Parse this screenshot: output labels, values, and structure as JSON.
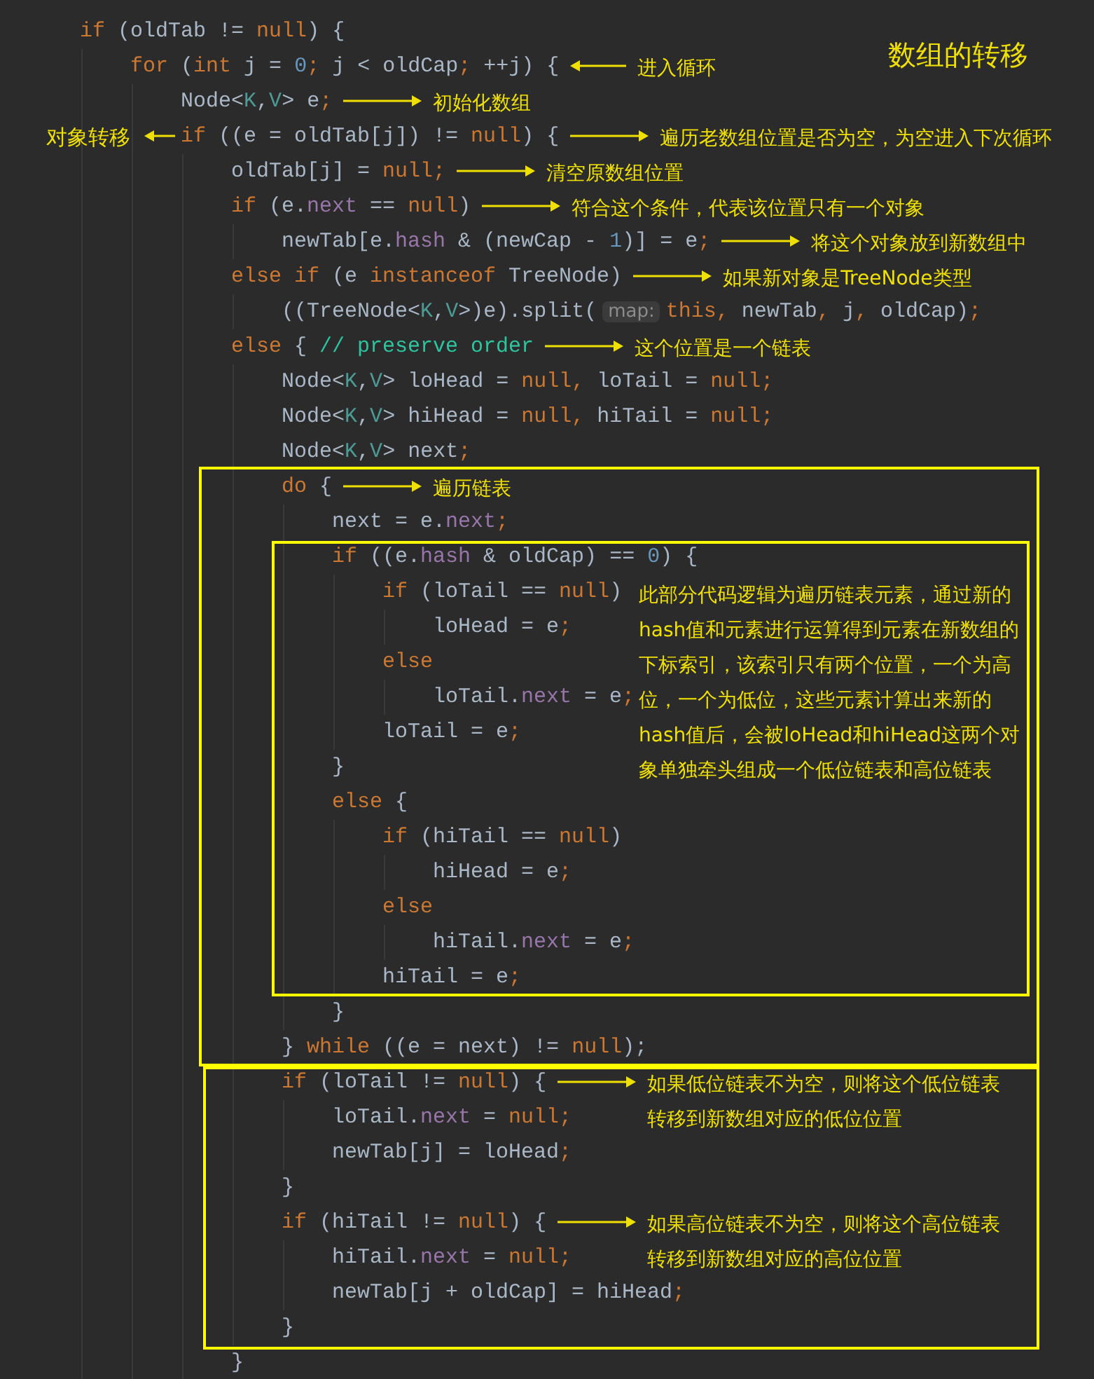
{
  "title": "数组的转移",
  "summary_note": "此部分代码逻辑为遍历链表元素，通过新的hash值和元素进行运算得到元素在新数组的下标索引，该索引只有两个位置，一个为高位，一个为低位，这些元素计算出来新的hash值后，会被loHead和hiHead这两个对象单独牵头组成一个低位链表和高位链表",
  "code": [
    {
      "tokens": [
        {
          "text": "if",
          "kind": "keyword"
        },
        {
          "text": " (oldTab != ",
          "kind": "plain"
        },
        {
          "text": "null",
          "kind": "keyword"
        },
        {
          "text": ") {",
          "kind": "plain"
        }
      ],
      "children": [
        {
          "tokens": [
            {
              "text": "for",
              "kind": "keyword"
            },
            {
              "text": " (",
              "kind": "plain"
            },
            {
              "text": "int",
              "kind": "keyword"
            },
            {
              "text": " j = ",
              "kind": "plain"
            },
            {
              "text": "0",
              "kind": "number"
            },
            {
              "text": ";",
              "kind": "punct"
            },
            {
              "text": " j < oldCap",
              "kind": "plain"
            },
            {
              "text": ";",
              "kind": "punct"
            },
            {
              "text": " ++j) {",
              "kind": "plain"
            }
          ],
          "note": {
            "text": "进入循环",
            "points_left": true
          },
          "children": [
            {
              "tokens": [
                {
                  "text": "Node<",
                  "kind": "plain"
                },
                {
                  "text": "K",
                  "kind": "generic"
                },
                {
                  "text": ",",
                  "kind": "plain"
                },
                {
                  "text": "V",
                  "kind": "generic"
                },
                {
                  "text": "> e",
                  "kind": "plain"
                },
                {
                  "text": ";",
                  "kind": "punct"
                }
              ],
              "note": {
                "text": "初始化数组",
                "points_left": false
              }
            },
            {
              "tokens": [
                {
                  "text": "if",
                  "kind": "keyword"
                },
                {
                  "text": " ((e = oldTab[j]) != ",
                  "kind": "plain"
                },
                {
                  "text": "null",
                  "kind": "keyword"
                },
                {
                  "text": ") {",
                  "kind": "plain"
                }
              ],
              "note": {
                "text": "遍历老数组位置是否为空，为空进入下次循环",
                "points_left": false
              },
              "margin_note": {
                "text": "对象转移",
                "points_left": true
              },
              "children": [
                {
                  "tokens": [
                    {
                      "text": "oldTab[j] = ",
                      "kind": "plain"
                    },
                    {
                      "text": "null;",
                      "kind": "keyword"
                    }
                  ],
                  "note": {
                    "text": "清空原数组位置",
                    "points_left": false
                  }
                },
                {
                  "tokens": [
                    {
                      "text": "if",
                      "kind": "keyword"
                    },
                    {
                      "text": " (e.",
                      "kind": "plain"
                    },
                    {
                      "text": "next",
                      "kind": "field"
                    },
                    {
                      "text": " == ",
                      "kind": "plain"
                    },
                    {
                      "text": "null",
                      "kind": "keyword"
                    },
                    {
                      "text": ")",
                      "kind": "plain"
                    }
                  ],
                  "note": {
                    "text": "符合这个条件，代表该位置只有一个对象",
                    "points_left": false
                  },
                  "children": [
                    {
                      "tokens": [
                        {
                          "text": "newTab[e.",
                          "kind": "plain"
                        },
                        {
                          "text": "hash",
                          "kind": "field"
                        },
                        {
                          "text": " & (newCap - ",
                          "kind": "plain"
                        },
                        {
                          "text": "1",
                          "kind": "number"
                        },
                        {
                          "text": ")] = e",
                          "kind": "plain"
                        },
                        {
                          "text": ";",
                          "kind": "punct"
                        }
                      ],
                      "note": {
                        "text": "将这个对象放到新数组中",
                        "points_left": false
                      }
                    }
                  ]
                },
                {
                  "tokens": [
                    {
                      "text": "else if",
                      "kind": "keyword"
                    },
                    {
                      "text": " (e ",
                      "kind": "plain"
                    },
                    {
                      "text": "instanceof",
                      "kind": "keyword"
                    },
                    {
                      "text": " TreeNode)",
                      "kind": "plain"
                    }
                  ],
                  "note": {
                    "text": "如果新对象是TreeNode类型",
                    "points_left": false
                  },
                  "children": [
                    {
                      "tokens": [
                        {
                          "text": "((TreeNode<",
                          "kind": "plain"
                        },
                        {
                          "text": "K",
                          "kind": "generic"
                        },
                        {
                          "text": ",",
                          "kind": "plain"
                        },
                        {
                          "text": "V",
                          "kind": "generic"
                        },
                        {
                          "text": ">)e).split(",
                          "kind": "plain"
                        },
                        {
                          "text": "map:",
                          "kind": "hint"
                        },
                        {
                          "text": "this",
                          "kind": "keyword"
                        },
                        {
                          "text": ", ",
                          "kind": "punct"
                        },
                        {
                          "text": "newTab",
                          "kind": "plain"
                        },
                        {
                          "text": ", ",
                          "kind": "punct"
                        },
                        {
                          "text": "j",
                          "kind": "plain"
                        },
                        {
                          "text": ", ",
                          "kind": "punct"
                        },
                        {
                          "text": "oldCap)",
                          "kind": "plain"
                        },
                        {
                          "text": ";",
                          "kind": "punct"
                        }
                      ]
                    }
                  ]
                },
                {
                  "tokens": [
                    {
                      "text": "else",
                      "kind": "keyword"
                    },
                    {
                      "text": " { ",
                      "kind": "plain"
                    },
                    {
                      "text": "// preserve order",
                      "kind": "comment"
                    }
                  ],
                  "note": {
                    "text": "这个位置是一个链表",
                    "points_left": false
                  },
                  "children": [
                    {
                      "tokens": [
                        {
                          "text": "Node<",
                          "kind": "plain"
                        },
                        {
                          "text": "K",
                          "kind": "generic"
                        },
                        {
                          "text": ",",
                          "kind": "plain"
                        },
                        {
                          "text": "V",
                          "kind": "generic"
                        },
                        {
                          "text": "> loHead = ",
                          "kind": "plain"
                        },
                        {
                          "text": "null, ",
                          "kind": "keyword"
                        },
                        {
                          "text": "loTail = ",
                          "kind": "plain"
                        },
                        {
                          "text": "null;",
                          "kind": "keyword"
                        }
                      ]
                    },
                    {
                      "tokens": [
                        {
                          "text": "Node<",
                          "kind": "plain"
                        },
                        {
                          "text": "K",
                          "kind": "generic"
                        },
                        {
                          "text": ",",
                          "kind": "plain"
                        },
                        {
                          "text": "V",
                          "kind": "generic"
                        },
                        {
                          "text": "> hiHead = ",
                          "kind": "plain"
                        },
                        {
                          "text": "null, ",
                          "kind": "keyword"
                        },
                        {
                          "text": "hiTail = ",
                          "kind": "plain"
                        },
                        {
                          "text": "null;",
                          "kind": "keyword"
                        }
                      ]
                    },
                    {
                      "tokens": [
                        {
                          "text": "Node<",
                          "kind": "plain"
                        },
                        {
                          "text": "K",
                          "kind": "generic"
                        },
                        {
                          "text": ",",
                          "kind": "plain"
                        },
                        {
                          "text": "V",
                          "kind": "generic"
                        },
                        {
                          "text": "> next",
                          "kind": "plain"
                        },
                        {
                          "text": ";",
                          "kind": "punct"
                        }
                      ]
                    },
                    {
                      "tokens": [
                        {
                          "text": "do",
                          "kind": "keyword"
                        },
                        {
                          "text": " {",
                          "kind": "plain"
                        }
                      ],
                      "note": {
                        "text": "遍历链表",
                        "points_left": false
                      },
                      "children": [
                        {
                          "tokens": [
                            {
                              "text": "next = e.",
                              "kind": "plain"
                            },
                            {
                              "text": "next",
                              "kind": "field"
                            },
                            {
                              "text": ";",
                              "kind": "punct"
                            }
                          ]
                        },
                        {
                          "tokens": [
                            {
                              "text": "if",
                              "kind": "keyword"
                            },
                            {
                              "text": " ((e.",
                              "kind": "plain"
                            },
                            {
                              "text": "hash",
                              "kind": "field"
                            },
                            {
                              "text": " & oldCap) == ",
                              "kind": "plain"
                            },
                            {
                              "text": "0",
                              "kind": "number"
                            },
                            {
                              "text": ") {",
                              "kind": "plain"
                            }
                          ],
                          "children": [
                            {
                              "tokens": [
                                {
                                  "text": "if",
                                  "kind": "keyword"
                                },
                                {
                                  "text": " (loTail == ",
                                  "kind": "plain"
                                },
                                {
                                  "text": "null",
                                  "kind": "keyword"
                                },
                                {
                                  "text": ")",
                                  "kind": "plain"
                                }
                              ],
                              "children": [
                                {
                                  "tokens": [
                                    {
                                      "text": "loHead = e",
                                      "kind": "plain"
                                    },
                                    {
                                      "text": ";",
                                      "kind": "punct"
                                    }
                                  ]
                                }
                              ]
                            },
                            {
                              "tokens": [
                                {
                                  "text": "else",
                                  "kind": "keyword"
                                }
                              ],
                              "children": [
                                {
                                  "tokens": [
                                    {
                                      "text": "loTail.",
                                      "kind": "plain"
                                    },
                                    {
                                      "text": "next",
                                      "kind": "field"
                                    },
                                    {
                                      "text": " = e",
                                      "kind": "plain"
                                    },
                                    {
                                      "text": ";",
                                      "kind": "punct"
                                    }
                                  ]
                                }
                              ]
                            },
                            {
                              "tokens": [
                                {
                                  "text": "loTail = e",
                                  "kind": "plain"
                                },
                                {
                                  "text": ";",
                                  "kind": "punct"
                                }
                              ]
                            }
                          ]
                        },
                        {
                          "tokens": [
                            {
                              "text": "}",
                              "kind": "plain"
                            }
                          ]
                        },
                        {
                          "tokens": [
                            {
                              "text": "else",
                              "kind": "keyword"
                            },
                            {
                              "text": " {",
                              "kind": "plain"
                            }
                          ],
                          "children": [
                            {
                              "tokens": [
                                {
                                  "text": "if",
                                  "kind": "keyword"
                                },
                                {
                                  "text": " (hiTail == ",
                                  "kind": "plain"
                                },
                                {
                                  "text": "null",
                                  "kind": "keyword"
                                },
                                {
                                  "text": ")",
                                  "kind": "plain"
                                }
                              ],
                              "children": [
                                {
                                  "tokens": [
                                    {
                                      "text": "hiHead = e",
                                      "kind": "plain"
                                    },
                                    {
                                      "text": ";",
                                      "kind": "punct"
                                    }
                                  ]
                                }
                              ]
                            },
                            {
                              "tokens": [
                                {
                                  "text": "else",
                                  "kind": "keyword"
                                }
                              ],
                              "children": [
                                {
                                  "tokens": [
                                    {
                                      "text": "hiTail.",
                                      "kind": "plain"
                                    },
                                    {
                                      "text": "next",
                                      "kind": "field"
                                    },
                                    {
                                      "text": " = e",
                                      "kind": "plain"
                                    },
                                    {
                                      "text": ";",
                                      "kind": "punct"
                                    }
                                  ]
                                }
                              ]
                            },
                            {
                              "tokens": [
                                {
                                  "text": "hiTail = e",
                                  "kind": "plain"
                                },
                                {
                                  "text": ";",
                                  "kind": "punct"
                                }
                              ]
                            }
                          ]
                        },
                        {
                          "tokens": [
                            {
                              "text": "}",
                              "kind": "plain"
                            }
                          ]
                        }
                      ]
                    },
                    {
                      "tokens": [
                        {
                          "text": "} ",
                          "kind": "plain"
                        },
                        {
                          "text": "while",
                          "kind": "keyword"
                        },
                        {
                          "text": " ((e = next) != ",
                          "kind": "plain"
                        },
                        {
                          "text": "null",
                          "kind": "keyword"
                        },
                        {
                          "text": ");",
                          "kind": "plain"
                        }
                      ]
                    },
                    {
                      "tokens": [
                        {
                          "text": "if",
                          "kind": "keyword"
                        },
                        {
                          "text": " (loTail != ",
                          "kind": "plain"
                        },
                        {
                          "text": "null",
                          "kind": "keyword"
                        },
                        {
                          "text": ") {",
                          "kind": "plain"
                        }
                      ],
                      "note": {
                        "lines": [
                          "如果低位链表不为空，则将这个低位链表",
                          "转移到新数组对应的低位位置"
                        ],
                        "points_left": false
                      },
                      "children": [
                        {
                          "tokens": [
                            {
                              "text": "loTail.",
                              "kind": "plain"
                            },
                            {
                              "text": "next",
                              "kind": "field"
                            },
                            {
                              "text": " = ",
                              "kind": "plain"
                            },
                            {
                              "text": "null;",
                              "kind": "keyword"
                            }
                          ]
                        },
                        {
                          "tokens": [
                            {
                              "text": "newTab[j] = loHead",
                              "kind": "plain"
                            },
                            {
                              "text": ";",
                              "kind": "punct"
                            }
                          ]
                        }
                      ]
                    },
                    {
                      "tokens": [
                        {
                          "text": "}",
                          "kind": "plain"
                        }
                      ]
                    },
                    {
                      "tokens": [
                        {
                          "text": "if",
                          "kind": "keyword"
                        },
                        {
                          "text": " (hiTail != ",
                          "kind": "plain"
                        },
                        {
                          "text": "null",
                          "kind": "keyword"
                        },
                        {
                          "text": ") {",
                          "kind": "plain"
                        }
                      ],
                      "note": {
                        "lines": [
                          "如果高位链表不为空，则将这个高位链表",
                          "转移到新数组对应的高位位置"
                        ],
                        "points_left": false
                      },
                      "children": [
                        {
                          "tokens": [
                            {
                              "text": "hiTail.",
                              "kind": "plain"
                            },
                            {
                              "text": "next",
                              "kind": "field"
                            },
                            {
                              "text": " = ",
                              "kind": "plain"
                            },
                            {
                              "text": "null;",
                              "kind": "keyword"
                            }
                          ]
                        },
                        {
                          "tokens": [
                            {
                              "text": "newTab[j + oldCap] = hiHead",
                              "kind": "plain"
                            },
                            {
                              "text": ";",
                              "kind": "punct"
                            }
                          ]
                        }
                      ]
                    },
                    {
                      "tokens": [
                        {
                          "text": "}",
                          "kind": "plain"
                        }
                      ]
                    }
                  ]
                },
                {
                  "tokens": [
                    {
                      "text": "}",
                      "kind": "plain"
                    }
                  ]
                }
              ]
            }
          ]
        }
      ]
    }
  ]
}
